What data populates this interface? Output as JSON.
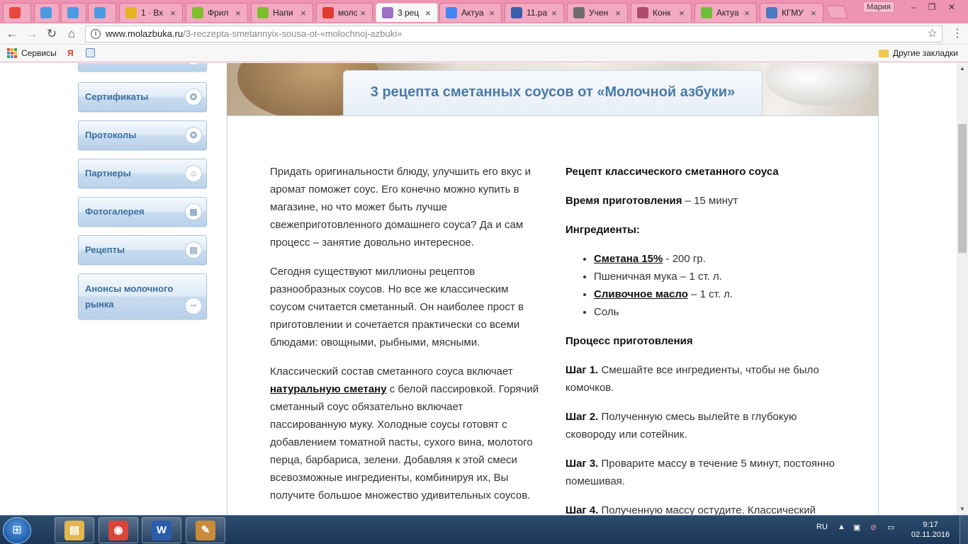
{
  "browser": {
    "tabs": [
      {
        "title": "",
        "icon": "opera-icon",
        "color": "#e8473b"
      },
      {
        "title": "",
        "icon": "apps-icon",
        "color": "#4a9be2"
      },
      {
        "title": "",
        "icon": "apps-icon",
        "color": "#4a9be2"
      },
      {
        "title": "",
        "icon": "apps-icon",
        "color": "#4a9be2"
      },
      {
        "title": "1 · Вх",
        "icon": "mail-icon",
        "color": "#e6b320"
      },
      {
        "title": "Фрил",
        "icon": "ru-icon",
        "color": "#7cbf2a"
      },
      {
        "title": "Напи",
        "icon": "ru-icon",
        "color": "#7cbf2a"
      },
      {
        "title": "моло",
        "icon": "yandex-icon",
        "color": "#e03a2f"
      },
      {
        "title": "3 рец",
        "icon": "site-icon",
        "color": "#9b6fc6",
        "active": true
      },
      {
        "title": "Актуа",
        "icon": "google-icon",
        "color": "#4285f4"
      },
      {
        "title": "11.ра",
        "icon": "bank-icon",
        "color": "#3a5fa8"
      },
      {
        "title": "Учен",
        "icon": "p-icon",
        "color": "#6d6d6d"
      },
      {
        "title": "Конк",
        "icon": "doc-icon",
        "color": "#b04a6e"
      },
      {
        "title": "Актуа",
        "icon": "play-icon",
        "color": "#6fbe3a"
      },
      {
        "title": "КГМУ",
        "icon": "globe-icon",
        "color": "#4a7ac0"
      }
    ],
    "profile": "Мария",
    "url": {
      "domain": "www.molazbuka.ru",
      "path": "/3-reczepta-smetannyix-sousa-ot-«molochnoj-azbuki»"
    },
    "bookmarks": {
      "services": "Сервисы",
      "yandex": "Я",
      "other": "Другие закладки"
    }
  },
  "sidebar": {
    "items": [
      {
        "label": "Сертификаты",
        "icon": "award-icon"
      },
      {
        "label": "Протоколы",
        "icon": "award-icon"
      },
      {
        "label": "Партнеры",
        "icon": "user-icon"
      },
      {
        "label": "Фотогалерея",
        "icon": "image-icon"
      },
      {
        "label": "Рецепты",
        "icon": "recipe-icon"
      },
      {
        "label": "Анонсы молочного рынка",
        "icon": "more-icon"
      }
    ]
  },
  "article": {
    "title": "3 рецепта сметанных соусов от «Молочной азбуки»",
    "left": {
      "p1": "Придать оригинальности блюду, улучшить его вкус и аромат поможет соус. Его конечно можно купить в магазине, но что может быть лучше свежеприготовленного домашнего соуса? Да и сам процесс – занятие довольно интересное.",
      "p2": "Сегодня существуют миллионы рецептов разнообразных соусов. Но все же классическим соусом считается сметанный. Он наиболее прост в приготовлении и сочетается практически со всеми блюдами: овощными, рыбными, мясными.",
      "p3_pre": "Классический состав сметанного соуса включает ",
      "p3_link": "натуральную сметану",
      "p3_post": " с белой пассировкой. Горячий сметанный соус обязательно включает пассированную муку. Холодные соусы готовят с добавлением томатной пасты, сухого вина, молотого перца, барбариса, зелени. Добавляя к этой смеси всевозможные ингредиенты, комбинируя их, Вы получите большое множество удивительных соусов."
    },
    "right": {
      "recipe_title": "Рецепт классического сметанного соуса",
      "time_label": "Время приготовления",
      "time_value": " – 15 минут",
      "ingredients_label": "Ингредиенты:",
      "ingredients": [
        {
          "link": "Сметана 15%",
          "text": " - 200 гр."
        },
        {
          "link": "",
          "text": "Пшеничная мука – 1 ст. л."
        },
        {
          "link": "Сливочное масло",
          "text": " – 1 ст. л."
        },
        {
          "link": "",
          "text": "Соль"
        }
      ],
      "process_label": "Процесс приготовления",
      "steps": [
        {
          "label": "Шаг 1.",
          "text": " Смешайте все ингредиенты, чтобы не было комочков."
        },
        {
          "label": "Шаг 2.",
          "text": " Полученную смесь вылейте в глубокую сковороду или сотейник."
        },
        {
          "label": "Шаг 3.",
          "text": " Проварите массу в течение 5 минут, постоянно помешивая."
        },
        {
          "label": "Шаг 4.",
          "text": " Полученную массу остудите. Классический"
        }
      ]
    }
  },
  "taskbar": {
    "apps": [
      {
        "name": "explorer",
        "glyph": "▤",
        "color": "#e2b84a"
      },
      {
        "name": "chrome",
        "glyph": "◉",
        "color": "#d9453a"
      },
      {
        "name": "word",
        "glyph": "W",
        "color": "#2a5cac"
      },
      {
        "name": "paint",
        "glyph": "✎",
        "color": "#c98b3a"
      }
    ],
    "lang": "RU",
    "time": "9:17",
    "date": "02.11.2016"
  },
  "colors": {
    "accent": "#4a7aa8",
    "tabbar": "#ef93b2"
  }
}
